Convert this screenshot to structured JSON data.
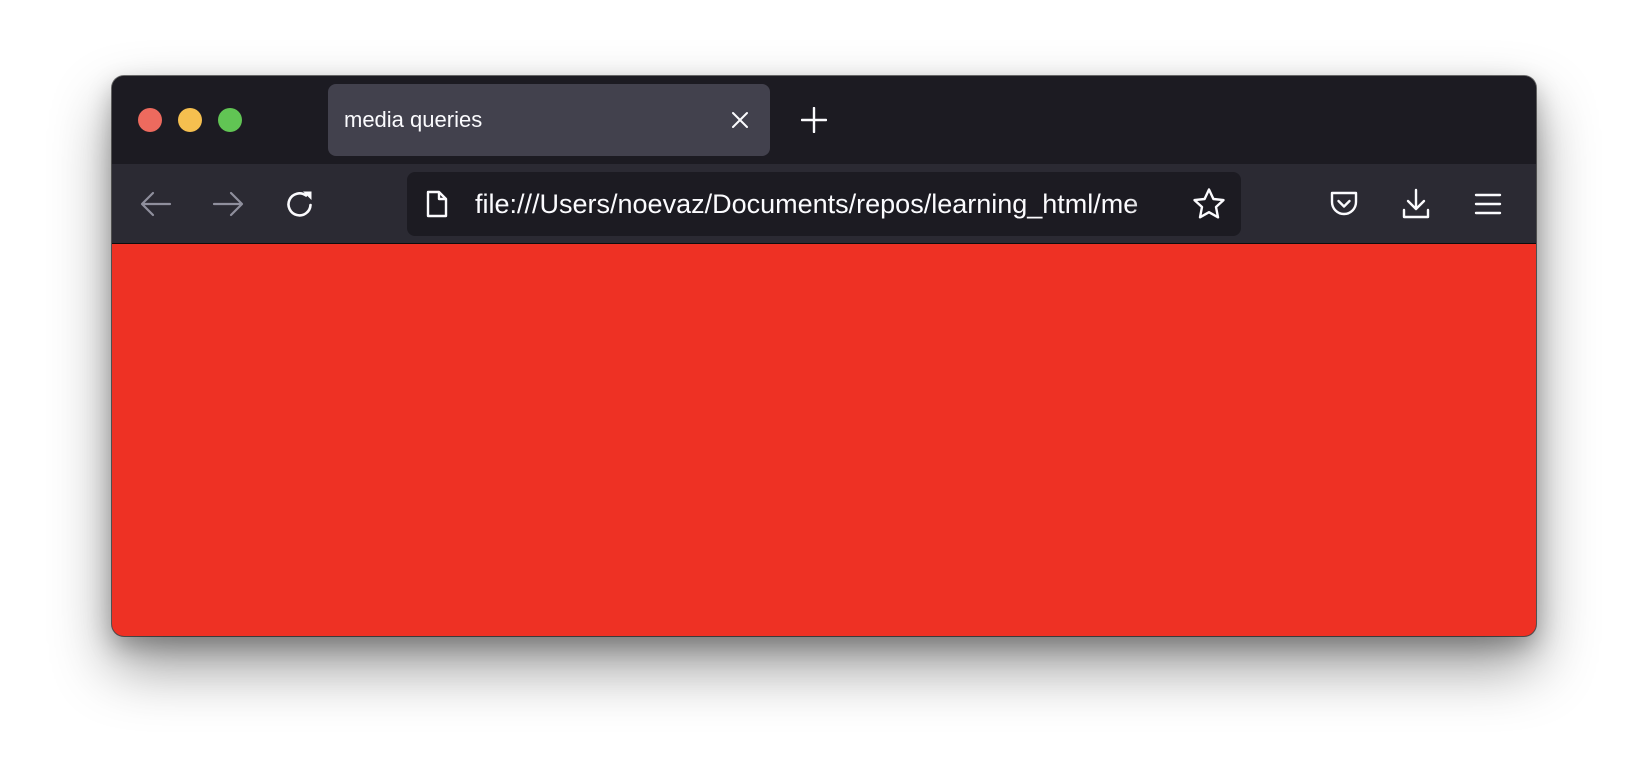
{
  "window": {
    "traffic_lights": {
      "close_color": "#ed6a5e",
      "minimize_color": "#f5bf4f",
      "maximize_color": "#61c554"
    }
  },
  "tabs": [
    {
      "title": "media queries",
      "active": true
    }
  ],
  "toolbar": {
    "back_icon": "arrow-left-icon",
    "forward_icon": "arrow-right-icon",
    "reload_icon": "reload-icon",
    "pocket_icon": "pocket-icon",
    "download_icon": "download-icon",
    "menu_icon": "hamburger-menu-icon"
  },
  "urlbar": {
    "page_icon": "document-icon",
    "url": "file:///Users/noevaz/Documents/repos/learning_html/me",
    "bookmark_icon": "star-icon"
  },
  "content": {
    "background_color": "#ee3124"
  }
}
